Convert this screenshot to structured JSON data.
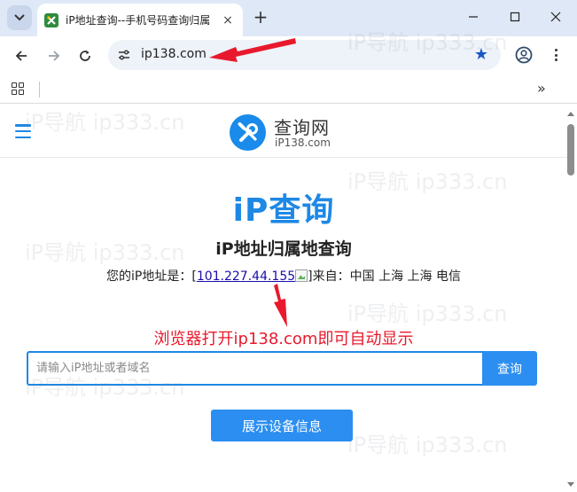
{
  "browser": {
    "tab_title": "iP地址查询--手机号码查询归属",
    "tab_close_glyph": "×",
    "new_tab_glyph": "+",
    "url": "ip138.com",
    "star_glyph": "★",
    "more_bookmarks_glyph": "»"
  },
  "site": {
    "logo_name": "查询网",
    "logo_domain": "iP138.com",
    "brand_title": "iP查询",
    "subtitle": "iP地址归属地查询",
    "ip_prefix": "您的iP地址是：[",
    "ip_address": "101.227.44.155",
    "ip_suffix": "]来自：中国 上海 上海 电信",
    "annotation": "浏览器打开ip138.com即可自动显示",
    "search": {
      "placeholder": "请输入iP地址或者域名",
      "button_label": "查询"
    },
    "device_button_label": "展示设备信息"
  },
  "watermark": {
    "text": "iP导航 ip333.cn"
  },
  "colors": {
    "accent": "#1e88e5",
    "annotation": "#e8192c",
    "tabstrip": "#dfe8f7"
  },
  "icons": [
    "tab-search-icon",
    "favicon",
    "back-arrow-icon",
    "forward-arrow-icon",
    "reload-icon",
    "site-info-icon",
    "star-icon",
    "profile-icon",
    "menu-icon",
    "apps-icon",
    "hamburger-icon",
    "logo-tools-icon"
  ]
}
